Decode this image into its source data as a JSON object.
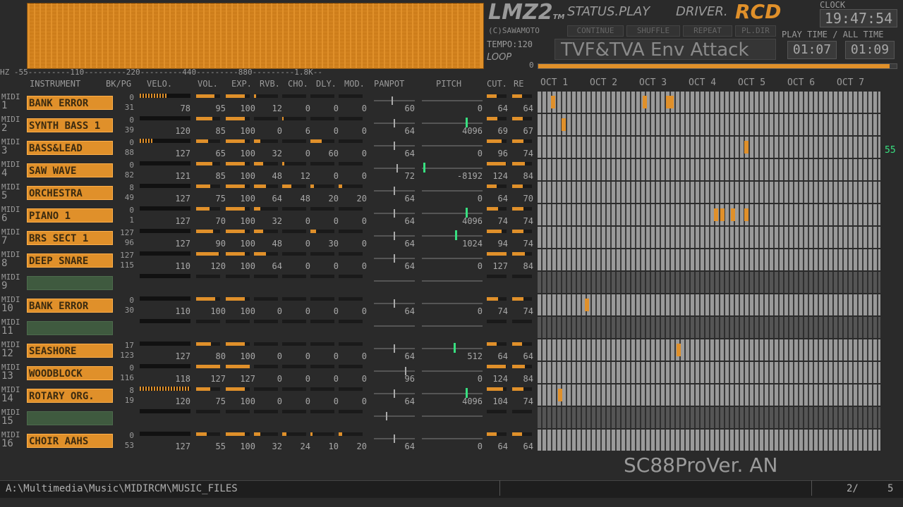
{
  "title": {
    "logo": "LMZ2",
    "logo_tm": "TM"
  },
  "status": {
    "label": "STATUS.",
    "value": "PLAY"
  },
  "driver": {
    "label": "DRIVER.",
    "value": "RCD"
  },
  "clock": {
    "label": "CLOCK",
    "value": "19:47:54"
  },
  "copyright": "(C)SAWAMOTO",
  "controls": [
    "CONTINUE",
    "SHUFFLE",
    "REPEAT",
    "PL.DIR"
  ],
  "tempo": "TEMPO:120",
  "loop": {
    "label": "LOOP",
    "value": "0"
  },
  "message": "TVF&TVA Env Attack",
  "playtime": {
    "label": "PLAY TIME / ALL TIME",
    "play": "01:07",
    "all": "01:09"
  },
  "hz_axis": "HZ -55---------110---------220---------440---------880---------1.8K--",
  "headers": {
    "instrument": "INSTRUMENT",
    "bkpg": "BK/PG",
    "velo": "VELO.",
    "vol": "VOL.",
    "exp": "EXP.",
    "rvb": "RVB.",
    "cho": "CHO.",
    "dly": "DLY.",
    "mod": "MOD.",
    "panpot": "PANPOT",
    "pitch": "PITCH",
    "cut": "CUT.",
    "re": "RE"
  },
  "octaves": [
    "OCT 1",
    "OCT 2",
    "OCT 3",
    "OCT 4",
    "OCT 5",
    "OCT 6",
    "OCT 7"
  ],
  "channels": [
    {
      "midi": "MIDI",
      "num": "1",
      "name": "BANK ERROR",
      "bk": "0",
      "pg": "31",
      "velo_level": 0.55,
      "vel": "78",
      "vol": "95",
      "exp": "100",
      "rvb": "12",
      "cho": "0",
      "dly": "0",
      "mod": "0",
      "pan": "60",
      "pitch": "0",
      "cut": "64",
      "re": "64",
      "pan_pos": 0.45,
      "pitch_pos": null,
      "notes": [
        0.04,
        0.31,
        0.38,
        0.39
      ]
    },
    {
      "midi": "MIDI",
      "num": "2",
      "name": "SYNTH BASS 1",
      "bk": "0",
      "pg": "39",
      "velo_level": 0,
      "vel": "120",
      "vol": "85",
      "exp": "100",
      "rvb": "0",
      "cho": "6",
      "dly": "0",
      "mod": "0",
      "pan": "64",
      "pitch": "4096",
      "cut": "69",
      "re": "67",
      "pan_pos": 0.5,
      "pitch_pos": 0.74,
      "notes": [
        0.07
      ]
    },
    {
      "midi": "MIDI",
      "num": "3",
      "name": "BASS&LEAD",
      "bk": "0",
      "pg": "88",
      "velo_level": 0.25,
      "vel": "127",
      "vol": "65",
      "exp": "100",
      "rvb": "32",
      "cho": "0",
      "dly": "60",
      "mod": "0",
      "pan": "64",
      "pitch": "0",
      "cut": "96",
      "re": "74",
      "pan_pos": 0.5,
      "pitch_pos": null,
      "notes": [
        0.61
      ]
    },
    {
      "midi": "MIDI",
      "num": "4",
      "name": "SAW WAVE",
      "bk": "0",
      "pg": "82",
      "velo_level": 0,
      "vel": "121",
      "vol": "85",
      "exp": "100",
      "rvb": "48",
      "cho": "12",
      "dly": "0",
      "mod": "0",
      "pan": "72",
      "pitch": "-8192",
      "cut": "124",
      "re": "84",
      "pan_pos": 0.58,
      "pitch_pos": 0.02,
      "notes": []
    },
    {
      "midi": "MIDI",
      "num": "5",
      "name": "ORCHESTRA",
      "bk": "8",
      "pg": "49",
      "velo_level": 0,
      "vel": "127",
      "vol": "75",
      "exp": "100",
      "rvb": "64",
      "cho": "48",
      "dly": "20",
      "mod": "20",
      "pan": "64",
      "pitch": "0",
      "cut": "64",
      "re": "70",
      "pan_pos": 0.5,
      "pitch_pos": null,
      "notes": []
    },
    {
      "midi": "MIDI",
      "num": "6",
      "name": "PIANO 1",
      "bk": "0",
      "pg": "1",
      "velo_level": 0,
      "vel": "127",
      "vol": "70",
      "exp": "100",
      "rvb": "32",
      "cho": "0",
      "dly": "0",
      "mod": "0",
      "pan": "64",
      "pitch": "4096",
      "cut": "74",
      "re": "74",
      "pan_pos": 0.5,
      "pitch_pos": 0.74,
      "notes": [
        0.52,
        0.54,
        0.57,
        0.61
      ]
    },
    {
      "midi": "MIDI",
      "num": "7",
      "name": "BRS SECT 1",
      "bk": "127",
      "pg": "96",
      "velo_level": 0,
      "vel": "127",
      "vol": "90",
      "exp": "100",
      "rvb": "48",
      "cho": "0",
      "dly": "30",
      "mod": "0",
      "pan": "64",
      "pitch": "1024",
      "cut": "94",
      "re": "74",
      "pan_pos": 0.5,
      "pitch_pos": 0.56,
      "notes": []
    },
    {
      "midi": "MIDI",
      "num": "8",
      "name": "DEEP SNARE",
      "bk": "127",
      "pg": "115",
      "velo_level": 0,
      "vel": "110",
      "vol": "120",
      "exp": "100",
      "rvb": "64",
      "cho": "0",
      "dly": "0",
      "mod": "0",
      "pan": "64",
      "pitch": "0",
      "cut": "127",
      "re": "84",
      "pan_pos": 0.5,
      "pitch_pos": null,
      "notes": []
    },
    {
      "midi": "MIDI",
      "num": "9",
      "name": "",
      "bk": "",
      "pg": "",
      "velo_level": 0,
      "vel": "",
      "vol": "",
      "exp": "",
      "rvb": "",
      "cho": "",
      "dly": "",
      "mod": "",
      "pan": "",
      "pitch": "",
      "cut": "",
      "re": "",
      "pan_pos": null,
      "pitch_pos": null,
      "notes": [],
      "empty": true
    },
    {
      "midi": "MIDI",
      "num": "10",
      "name": "BANK ERROR",
      "bk": "0",
      "pg": "30",
      "velo_level": 0,
      "vel": "110",
      "vol": "100",
      "exp": "100",
      "rvb": "0",
      "cho": "0",
      "dly": "0",
      "mod": "0",
      "pan": "64",
      "pitch": "0",
      "cut": "74",
      "re": "74",
      "pan_pos": 0.5,
      "pitch_pos": null,
      "notes": [
        0.14
      ]
    },
    {
      "midi": "MIDI",
      "num": "11",
      "name": "",
      "bk": "",
      "pg": "",
      "velo_level": 0,
      "vel": "",
      "vol": "",
      "exp": "",
      "rvb": "",
      "cho": "",
      "dly": "",
      "mod": "",
      "pan": "",
      "pitch": "",
      "cut": "",
      "re": "",
      "pan_pos": null,
      "pitch_pos": null,
      "notes": [],
      "empty": true
    },
    {
      "midi": "MIDI",
      "num": "12",
      "name": "SEASHORE",
      "bk": "17",
      "pg": "123",
      "velo_level": 0,
      "vel": "127",
      "vol": "80",
      "exp": "100",
      "rvb": "0",
      "cho": "0",
      "dly": "0",
      "mod": "0",
      "pan": "64",
      "pitch": "512",
      "cut": "64",
      "re": "64",
      "pan_pos": 0.5,
      "pitch_pos": 0.53,
      "notes": [
        0.41
      ]
    },
    {
      "midi": "MIDI",
      "num": "13",
      "name": "WOODBLOCK",
      "bk": "0",
      "pg": "116",
      "velo_level": 0,
      "vel": "118",
      "vol": "127",
      "exp": "127",
      "rvb": "0",
      "cho": "0",
      "dly": "0",
      "mod": "0",
      "pan": "96",
      "pitch": "0",
      "cut": "124",
      "re": "84",
      "pan_pos": 0.78,
      "pitch_pos": null,
      "notes": []
    },
    {
      "midi": "MIDI",
      "num": "14",
      "name": "ROTARY ORG.",
      "bk": "8",
      "pg": "19",
      "velo_level": 1,
      "vel": "120",
      "vol": "75",
      "exp": "100",
      "rvb": "0",
      "cho": "0",
      "dly": "0",
      "mod": "0",
      "pan": "64",
      "pitch": "4096",
      "cut": "104",
      "re": "74",
      "pan_pos": 0.5,
      "pitch_pos": 0.74,
      "notes": [
        0.06
      ]
    },
    {
      "midi": "MIDI",
      "num": "15",
      "name": "",
      "bk": "",
      "pg": "",
      "velo_level": 0,
      "vel": "",
      "vol": "",
      "exp": "",
      "rvb": "",
      "cho": "",
      "dly": "",
      "mod": "",
      "pan": "",
      "pitch": "",
      "cut": "",
      "re": "",
      "pan_pos": 0.3,
      "pitch_pos": null,
      "notes": [],
      "empty": true
    },
    {
      "midi": "MIDI",
      "num": "16",
      "name": "CHOIR AAHS",
      "bk": "0",
      "pg": "53",
      "velo_level": 0,
      "vel": "127",
      "vol": "55",
      "exp": "100",
      "rvb": "32",
      "cho": "24",
      "dly": "10",
      "mod": "20",
      "pan": "64",
      "pitch": "0",
      "cut": "64",
      "re": "64",
      "pan_pos": 0.5,
      "pitch_pos": null,
      "notes": []
    }
  ],
  "side_value": "55",
  "module_version": "SC88ProVer. AN",
  "statusbar": {
    "path": "A:\\Multimedia\\Music\\MIDIRCM\\MUSIC_FILES",
    "page": "2/",
    "total": "5"
  },
  "colors": {
    "accent": "#e0902a",
    "pitch_marker": "#38e080",
    "background": "#2a2a2a"
  }
}
